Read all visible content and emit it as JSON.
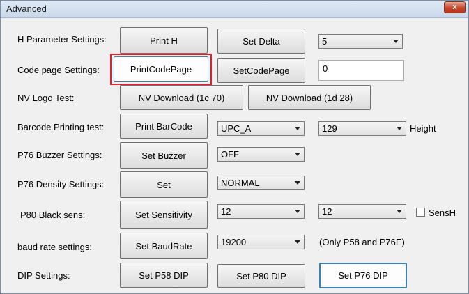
{
  "window": {
    "title": "Advanced",
    "close_glyph": "x"
  },
  "labels": {
    "h_param": "H Parameter Settings:",
    "code_page": "Code page Settings:",
    "nv_logo": "NV Logo Test:",
    "barcode": "Barcode Printing test:",
    "buzzer": "P76 Buzzer Settings:",
    "density": "P76 Density Settings:",
    "black_sens": "P80 Black sens:",
    "baud": "baud rate settings:",
    "dip": "DIP Settings:",
    "height": "Height",
    "sensh": "SensH",
    "baud_note": "(Only P58 and P76E)"
  },
  "buttons": {
    "print_h": "Print H",
    "set_delta": "Set Delta",
    "print_code_page": "PrintCodePage",
    "set_code_page": "SetCodePage",
    "nv_download_1c70": "NV Download (1c 70)",
    "nv_download_1d28": "NV Download (1d 28)",
    "print_barcode": "Print BarCode",
    "set_buzzer": "Set Buzzer",
    "set_density": "Set",
    "set_sensitivity": "Set Sensitivity",
    "set_baud_rate": "Set BaudRate",
    "set_p58_dip": "Set P58 DIP",
    "set_p80_dip": "Set P80 DIP",
    "set_p76_dip": "Set P76 DIP"
  },
  "combos": {
    "delta": "5",
    "barcode_type": "UPC_A",
    "barcode_height": "129",
    "buzzer": "OFF",
    "density": "NORMAL",
    "sensitivity": "12",
    "sensitivity2": "12",
    "baud_rate": "19200"
  },
  "inputs": {
    "code_page_value": "0"
  },
  "checkboxes": {
    "sensh_checked": false
  }
}
